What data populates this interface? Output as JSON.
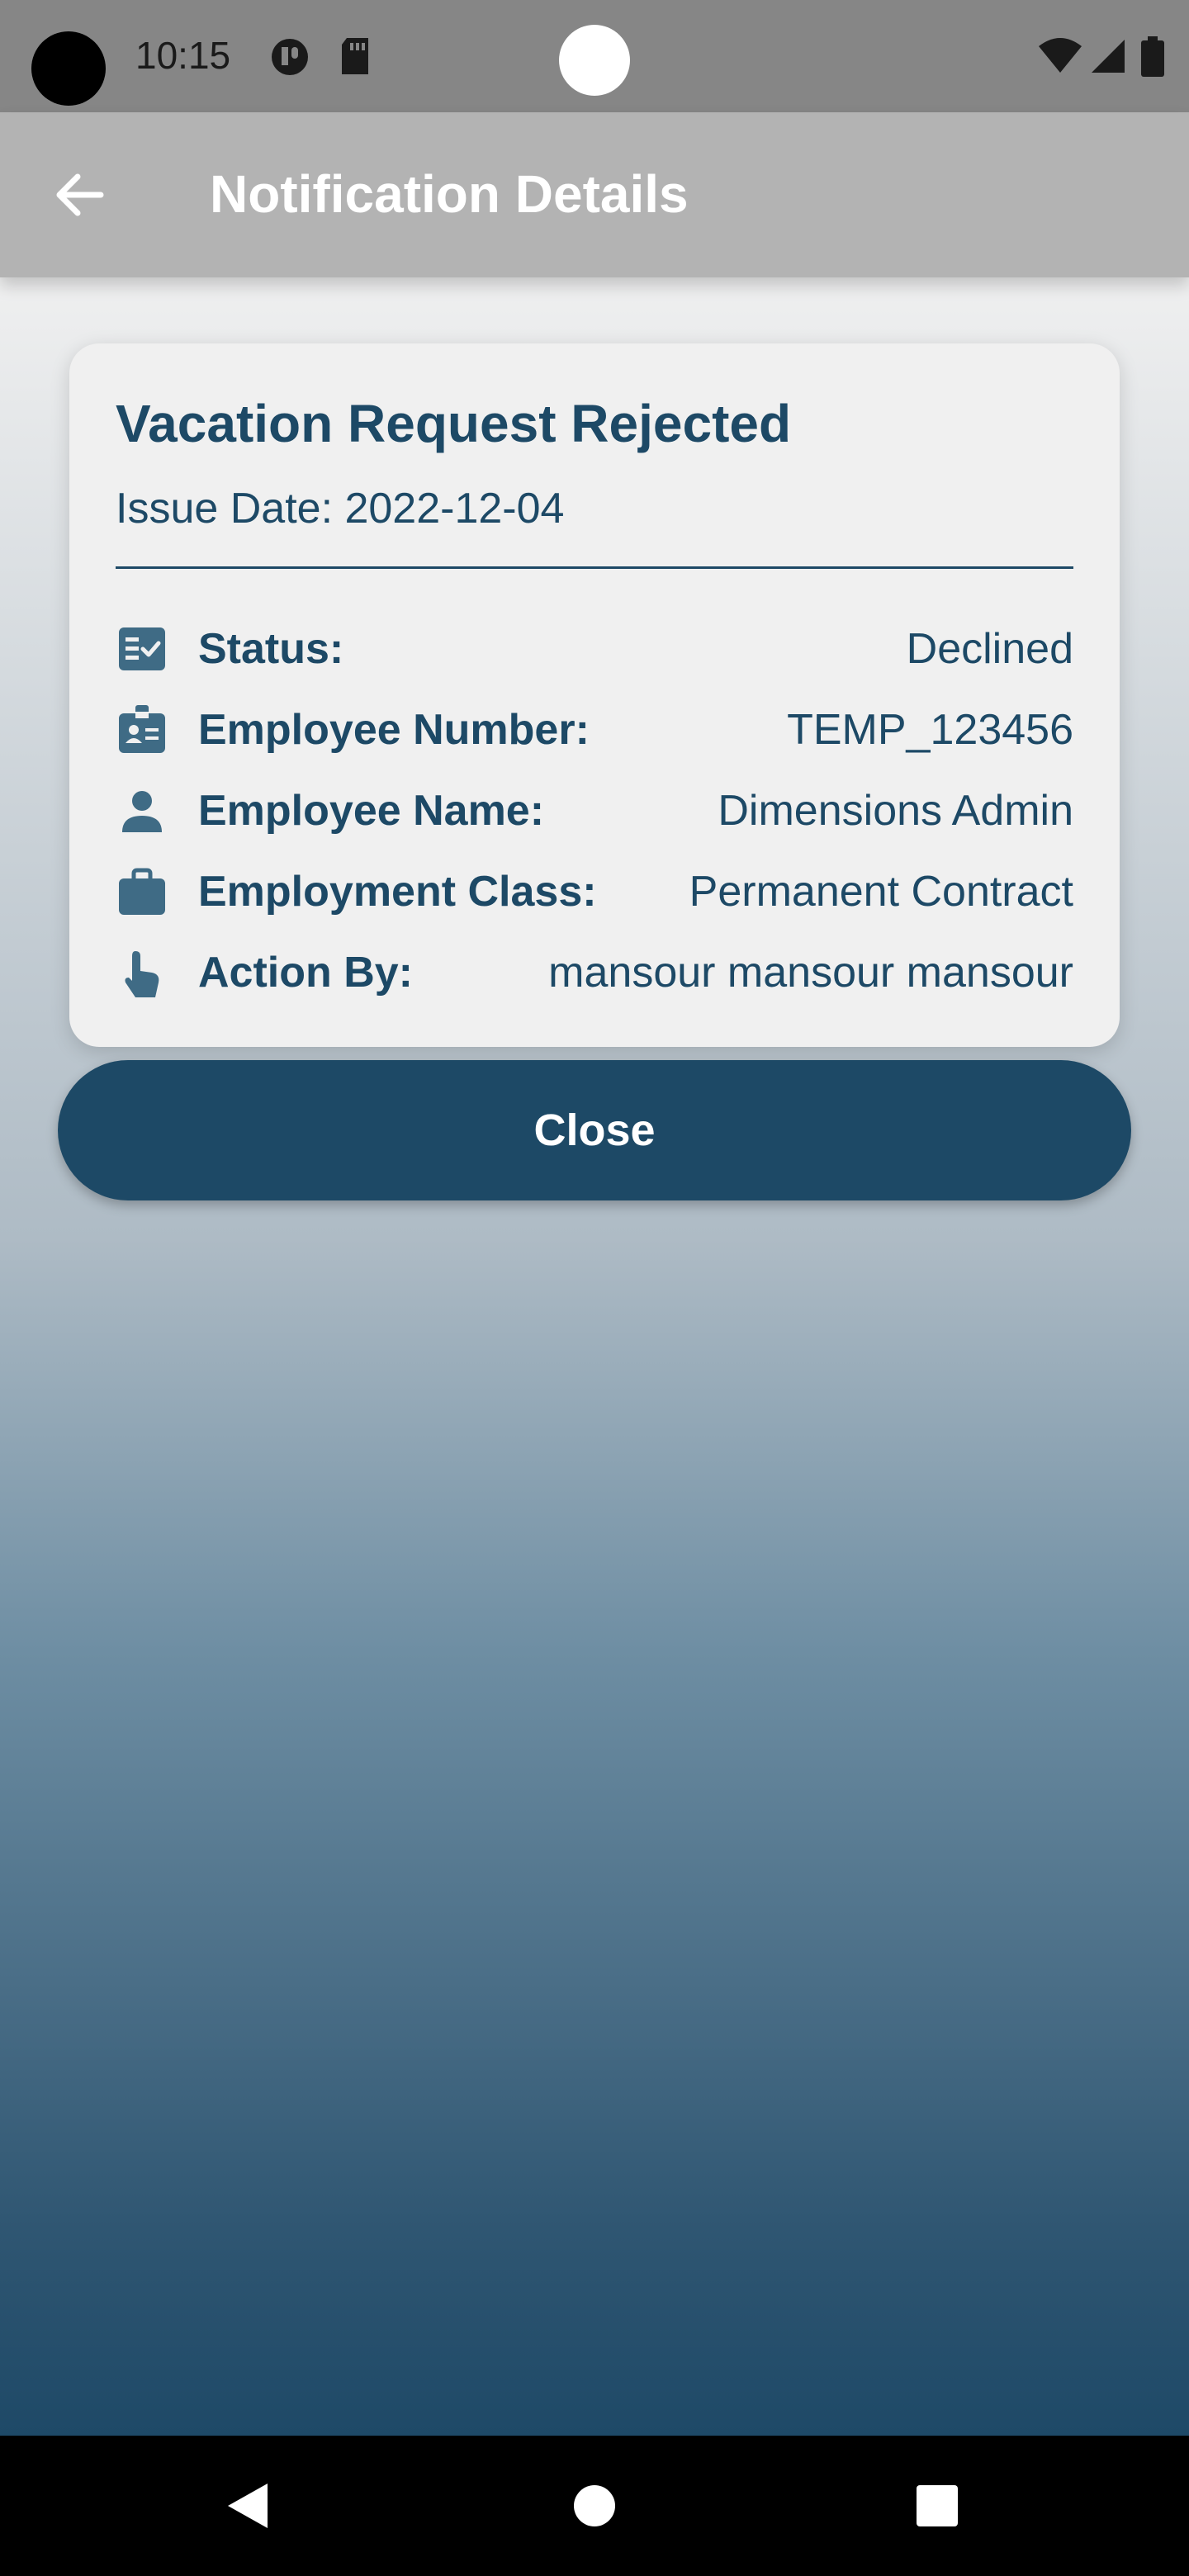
{
  "status_bar": {
    "time": "10:15"
  },
  "app_bar": {
    "title": "Notification Details"
  },
  "card": {
    "title": "Vacation Request Rejected",
    "issue_date": "Issue Date: 2022-12-04",
    "rows": [
      {
        "icon": "checklist-icon",
        "label": "Status:",
        "value": "Declined"
      },
      {
        "icon": "badge-icon",
        "label": "Employee Number:",
        "value": "TEMP_123456"
      },
      {
        "icon": "person-icon",
        "label": "Employee Name:",
        "value": "Dimensions Admin"
      },
      {
        "icon": "briefcase-icon",
        "label": "Employment Class:",
        "value": "Permanent Contract"
      },
      {
        "icon": "touch-icon",
        "label": "Action By:",
        "value": "mansour mansour mansour"
      }
    ]
  },
  "actions": {
    "close_label": "Close"
  },
  "colors": {
    "primary": "#1d4966",
    "app_bar": "#b3b3b3",
    "status_bar": "#868686"
  }
}
